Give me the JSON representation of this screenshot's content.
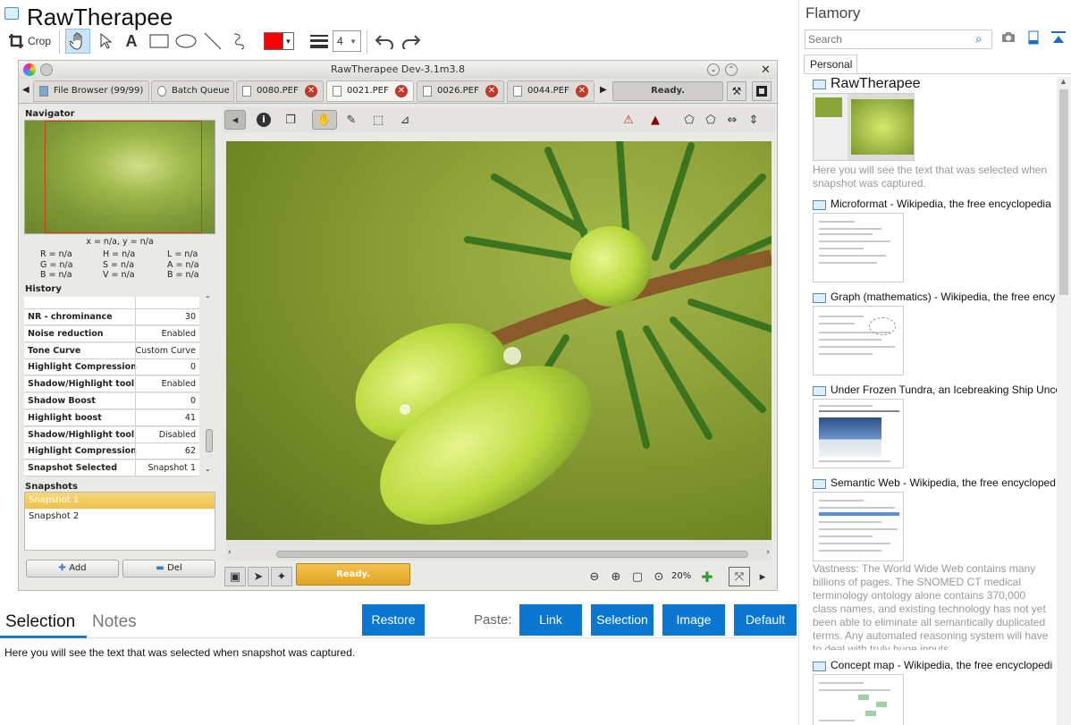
{
  "header": {
    "title": "RawTherapee"
  },
  "toolbar": {
    "crop_label": "Crop",
    "line_width": "4",
    "color": "#ff0000"
  },
  "screenshot": {
    "window_title": "RawTherapee Dev-3.1m3.8",
    "tabs": [
      {
        "label": "File Browser (99/99)"
      },
      {
        "label": "Batch Queue"
      },
      {
        "label": "0080.PEF"
      },
      {
        "label": "0021.PEF"
      },
      {
        "label": "0026.PEF"
      },
      {
        "label": "0044.PEF"
      }
    ],
    "status_top": "Ready.",
    "status_bottom": "Ready.",
    "navigator": {
      "title": "Navigator",
      "coords": "x = n/a, y = n/a",
      "r": "R = n/a",
      "g": "G = n/a",
      "b": "B = n/a",
      "h": "H = n/a",
      "s": "S = n/a",
      "v": "V = n/a",
      "l": "L = n/a",
      "a": "A = n/a",
      "bb": "B = n/a"
    },
    "history": {
      "title": "History",
      "rows": [
        {
          "name": "NR - chrominance",
          "value": "30"
        },
        {
          "name": "Noise reduction",
          "value": "Enabled"
        },
        {
          "name": "Tone Curve",
          "value": "Custom Curve"
        },
        {
          "name": "Highlight Compression",
          "value": "0"
        },
        {
          "name": "Shadow/Highlight tool",
          "value": "Enabled"
        },
        {
          "name": "Shadow Boost",
          "value": "0"
        },
        {
          "name": "Highlight boost",
          "value": "41"
        },
        {
          "name": "Shadow/Highlight tool",
          "value": "Disabled"
        },
        {
          "name": "Highlight Compression",
          "value": "62"
        },
        {
          "name": "Snapshot Selected",
          "value": "Snapshot 1"
        }
      ]
    },
    "snapshots": {
      "title": "Snapshots",
      "items": [
        "Snapshot 1",
        "Snapshot 2"
      ],
      "add_label": "Add",
      "del_label": "Del"
    },
    "zoom": "20%"
  },
  "bottom": {
    "tab_selection": "Selection",
    "tab_notes": "Notes",
    "restore": "Restore",
    "paste_label": "Paste:",
    "paste_link": "Link",
    "paste_selection": "Selection",
    "paste_image": "Image",
    "paste_default": "Default",
    "text": "Here you will see the text that was selected when snapshot was captured."
  },
  "flamory": {
    "title": "Flamory",
    "search_placeholder": "Search",
    "tab": "Personal",
    "items": [
      {
        "title": "RawTherapee",
        "desc": "Here you will see the text that was selected when snapshot was captured."
      },
      {
        "title": "Microformat - Wikipedia, the free encyclopedia",
        "desc": ""
      },
      {
        "title": "Graph (mathematics) - Wikipedia, the free ency",
        "desc": ""
      },
      {
        "title": "Under Frozen Tundra, an Icebreaking Ship Unco",
        "desc": ""
      },
      {
        "title": "Semantic Web - Wikipedia, the free encycloped",
        "desc": "Vastness: The World Wide Web contains many billions of pages. The SNOMED CT medical terminology ontology alone contains 370,000 class names, and existing technology has not yet been able to eliminate all semantically duplicated terms. Any automated reasoning system will have to deal with truly huge inputs."
      },
      {
        "title": "Concept map - Wikipedia, the free encyclopedi",
        "desc": ""
      }
    ]
  }
}
